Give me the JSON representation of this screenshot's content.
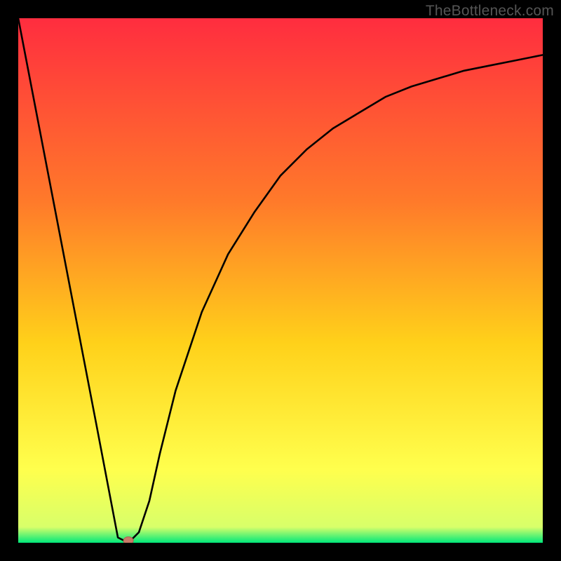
{
  "watermark": "TheBottleneck.com",
  "colors": {
    "frame": "#000000",
    "gradient_top": "#ff2d3f",
    "gradient_mid1": "#ff7a2a",
    "gradient_mid2": "#ffd11a",
    "gradient_mid3": "#ffff4d",
    "gradient_bottom": "#00e87a",
    "curve": "#000000",
    "marker_fill": "#c97a68",
    "marker_stroke": "#b06050"
  },
  "chart_data": {
    "type": "line",
    "title": "",
    "xlabel": "",
    "ylabel": "",
    "xlim": [
      0,
      100
    ],
    "ylim": [
      0,
      100
    ],
    "grid": false,
    "legend": false,
    "series": [
      {
        "name": "bottleneck-curve",
        "x": [
          0,
          5,
          10,
          15,
          19,
          21,
          23,
          25,
          27,
          30,
          35,
          40,
          45,
          50,
          55,
          60,
          65,
          70,
          75,
          80,
          85,
          90,
          95,
          100
        ],
        "y": [
          100,
          74,
          48,
          22,
          1,
          0,
          2,
          8,
          17,
          29,
          44,
          55,
          63,
          70,
          75,
          79,
          82,
          85,
          87,
          88.5,
          90,
          91,
          92,
          93
        ]
      }
    ],
    "marker": {
      "x": 21,
      "y": 0
    }
  }
}
